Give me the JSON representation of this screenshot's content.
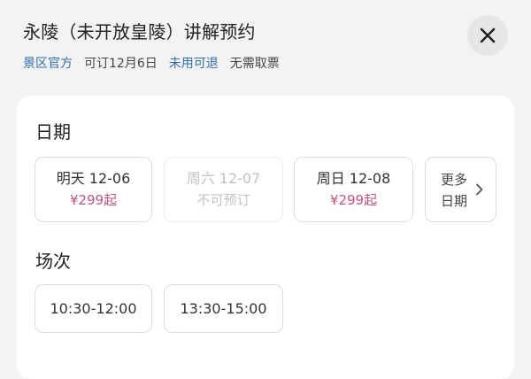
{
  "header": {
    "title": "永陵（未开放皇陵）讲解预约",
    "tags": [
      {
        "label": "景区官方",
        "color": "#2f6fb0"
      },
      {
        "label": "可订12月6日",
        "color": "#444444"
      },
      {
        "label": "未用可退",
        "color": "#2f6fb0"
      },
      {
        "label": "无需取票",
        "color": "#444444"
      }
    ],
    "close_icon": "close-icon"
  },
  "date_section": {
    "label": "日期",
    "chips": [
      {
        "date": "明天 12-06",
        "price": "¥299起",
        "enabled": true
      },
      {
        "date": "周六 12-07",
        "price": "不可预订",
        "enabled": false
      },
      {
        "date": "周日 12-08",
        "price": "¥299起",
        "enabled": true
      }
    ],
    "more": {
      "line1": "更多",
      "line2": "日期",
      "icon": "chevron-right-icon"
    }
  },
  "session_section": {
    "label": "场次",
    "slots": [
      "10:30-12:00",
      "13:30-15:00"
    ]
  },
  "colors": {
    "price": "#c4527a",
    "link": "#2f6fb0",
    "background": "#f3f3f3",
    "card": "#ffffff"
  }
}
